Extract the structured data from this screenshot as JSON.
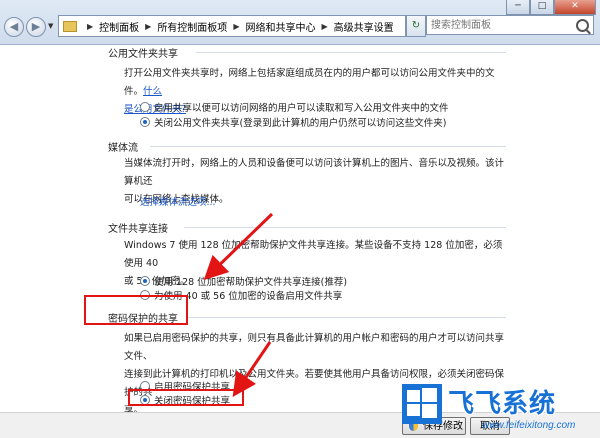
{
  "window": {
    "minimize_label": "─",
    "maximize_label": "□",
    "close_label": "✕"
  },
  "nav": {
    "back_icon": "back-arrow-icon",
    "forward_icon": "forward-arrow-icon"
  },
  "breadcrumb": {
    "items": [
      "控制面板",
      "所有控制面板项",
      "网络和共享中心",
      "高级共享设置"
    ]
  },
  "search": {
    "placeholder": "搜索控制面板"
  },
  "sections": {
    "public_folder": {
      "header": "公用文件夹共享",
      "description_line1": "打开公用文件夹共享时，网络上包括家庭组成员在内的用户都可以访问公用文件夹中的文件。",
      "link_inline": "什么",
      "link_line2": "是公用文件夹?",
      "options": [
        {
          "label": "启用共享以便可以访问网络的用户可以读取和写入公用文件夹中的文件",
          "selected": false
        },
        {
          "label": "关闭公用文件夹共享(登录到此计算机的用户仍然可以访问这些文件夹)",
          "selected": true
        }
      ]
    },
    "media": {
      "header": "媒体流",
      "description_line1": "当媒体流打开时，网络上的人员和设备便可以访问该计算机上的图片、音乐以及视频。该计算机还",
      "description_line2": "可以在网络上查找媒体。",
      "link": "选择媒体流选项..."
    },
    "file_sharing": {
      "header": "文件共享连接",
      "description_line1": "Windows 7 使用 128 位加密帮助保护文件共享连接。某些设备不支持 128 位加密，必须使用 40",
      "description_line2": "或 56 位加密。",
      "options": [
        {
          "label": "使用 128 位加密帮助保护文件共享连接(推荐)",
          "selected": true
        },
        {
          "label": "为使用 40 或 56 位加密的设备启用文件共享",
          "selected": false
        }
      ]
    },
    "password": {
      "header": "密码保护的共享",
      "description_line1": "如果已启用密码保护的共享，则只有具备此计算机的用户帐户和密码的用户才可以访问共享文件、",
      "description_line2": "连接到此计算机的打印机以及公用文件夹。若要使其他用户具备访问权限，必须关闭密码保护的共",
      "description_line3": "享。",
      "options": [
        {
          "label": "启用密码保护共享",
          "selected": false
        },
        {
          "label": "关闭密码保护共享",
          "selected": true
        }
      ]
    }
  },
  "footer": {
    "save_label": "保存修改",
    "cancel_label": "取消"
  },
  "watermark": {
    "brand": "飞飞系统",
    "url": "www.feifeixitong.com"
  },
  "colors": {
    "annotation": "#e21414",
    "link": "#1b56c8",
    "brand": "#1872d6"
  }
}
